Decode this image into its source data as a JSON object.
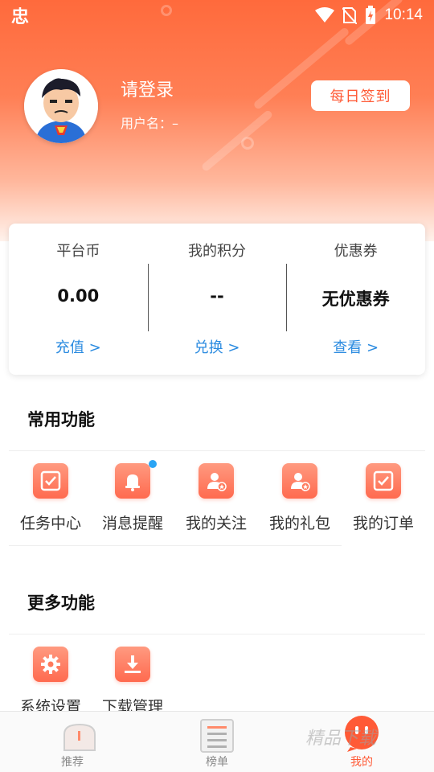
{
  "statusbar": {
    "app_glyph": "忠",
    "time": "10:14"
  },
  "profile": {
    "login_title": "请登录",
    "username_label": "用户名：–",
    "checkin_label": "每日签到"
  },
  "wallet": [
    {
      "label": "平台币",
      "value": "0.00",
      "link": "充值 >"
    },
    {
      "label": "我的积分",
      "value": "--",
      "link": "兑换 >"
    },
    {
      "label": "优惠券",
      "value": "无优惠券",
      "link": "查看 >"
    }
  ],
  "common": {
    "title": "常用功能",
    "items": [
      {
        "label": "任务中心",
        "icon": "checklist-icon"
      },
      {
        "label": "消息提醒",
        "icon": "bell-icon"
      },
      {
        "label": "我的关注",
        "icon": "user-star-icon"
      },
      {
        "label": "我的礼包",
        "icon": "user-star-icon"
      },
      {
        "label": "我的订单",
        "icon": "checklist-icon"
      }
    ]
  },
  "more": {
    "title": "更多功能",
    "items": [
      {
        "label": "系统设置",
        "icon": "gear-icon"
      },
      {
        "label": "下载管理",
        "icon": "download-icon"
      }
    ]
  },
  "bottomnav": {
    "tabs": [
      {
        "label": "推荐"
      },
      {
        "label": "榜单"
      },
      {
        "label": "我的"
      }
    ],
    "active_index": 2
  },
  "watermark": "精品下载",
  "colors": {
    "accent": "#ff5a36",
    "link": "#2b8be0",
    "badge": "#2aa4f4"
  }
}
